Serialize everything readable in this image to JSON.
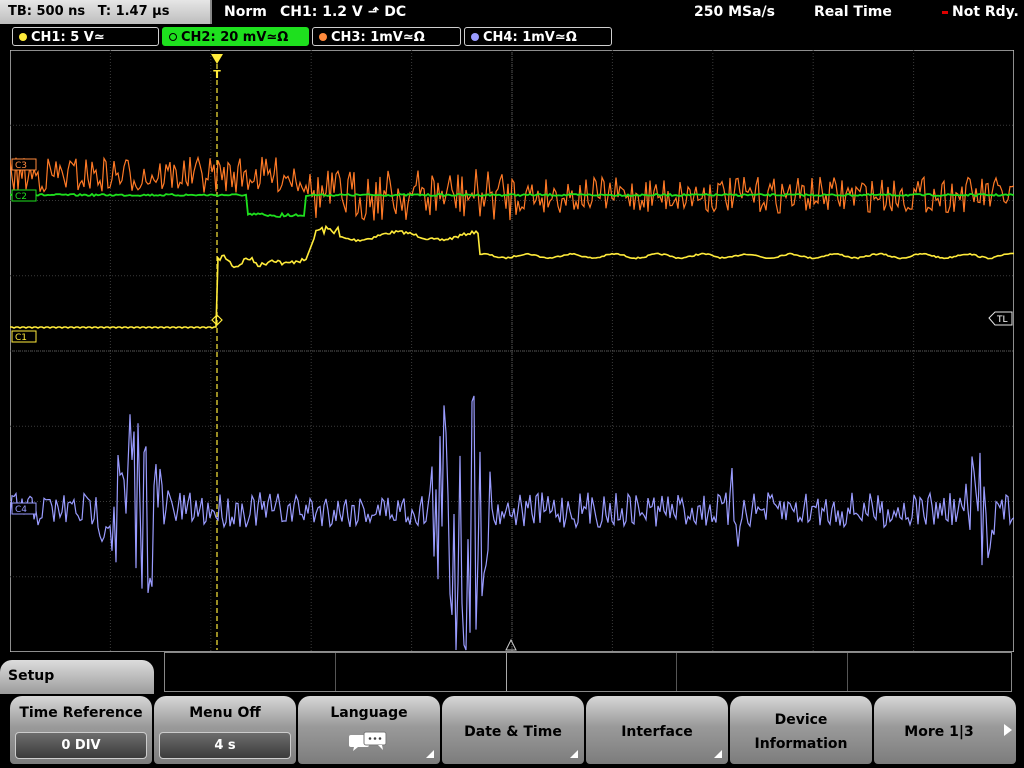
{
  "topbar": {
    "timebase": "TB: 500 ns",
    "trigger_time": "T: 1.47 µs",
    "trigger_mode": "Norm",
    "trigger_source": "CH1: 1.2 V ⬏ DC",
    "sample_rate": "250 MSa/s",
    "acquisition_mode": "Real Time",
    "status": "Not Rdy."
  },
  "channels": [
    {
      "label": "CH1: 5 V≃",
      "color": "#ffeb3b"
    },
    {
      "label": "CH2: 20 mV≃Ω",
      "color": "#1ee01e"
    },
    {
      "label": "CH3: 1mV≃Ω",
      "color": "#ff8a3d"
    },
    {
      "label": "CH4: 1mV≃Ω",
      "color": "#9a9cff"
    }
  ],
  "markers": {
    "c3": "C3",
    "c2": "C2",
    "c1": "C1",
    "c4": "C4",
    "trigger_level": "TL",
    "trigger_flag": "T"
  },
  "setup_title": "Setup",
  "softkeys": [
    {
      "label": "Time Reference",
      "value": "0 DIV"
    },
    {
      "label": "Menu Off",
      "value": "4 s"
    },
    {
      "label": "Language",
      "icon": "speech-bubbles-icon"
    },
    {
      "label": "Date & Time"
    },
    {
      "label": "Interface"
    },
    {
      "label_line1": "Device",
      "label_line2": "Information"
    },
    {
      "label": "More 1|3"
    }
  ]
}
